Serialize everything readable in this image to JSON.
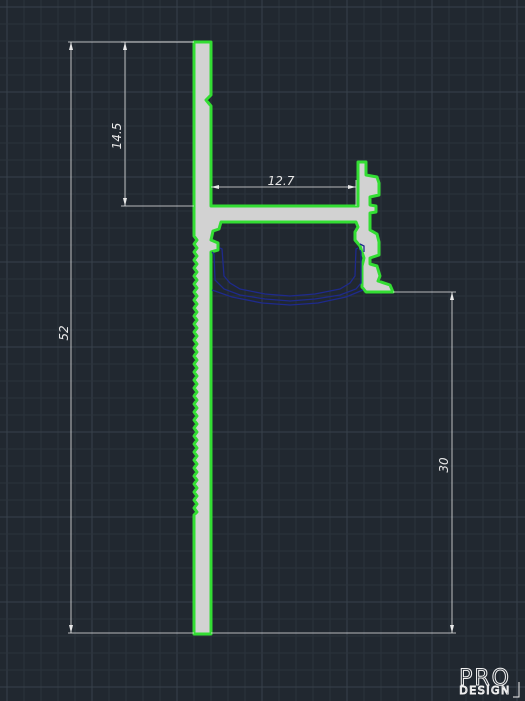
{
  "drawing": {
    "colors": {
      "background": "#212830",
      "grid_minor": "#2b333c",
      "grid_major": "#38414b",
      "profile_fill": "#d2d2d2",
      "profile_outline": "#33dd33",
      "diffuser": "#1e2a8c",
      "dimension": "#e8e8e8",
      "logo": "#f2f2f2"
    },
    "dimensions": {
      "overall_height": "52",
      "upper_section": "14.5",
      "shelf_depth": "12.7",
      "lower_section": "30"
    }
  },
  "logo": {
    "line1": "PRO",
    "line2": "DESIGN"
  }
}
